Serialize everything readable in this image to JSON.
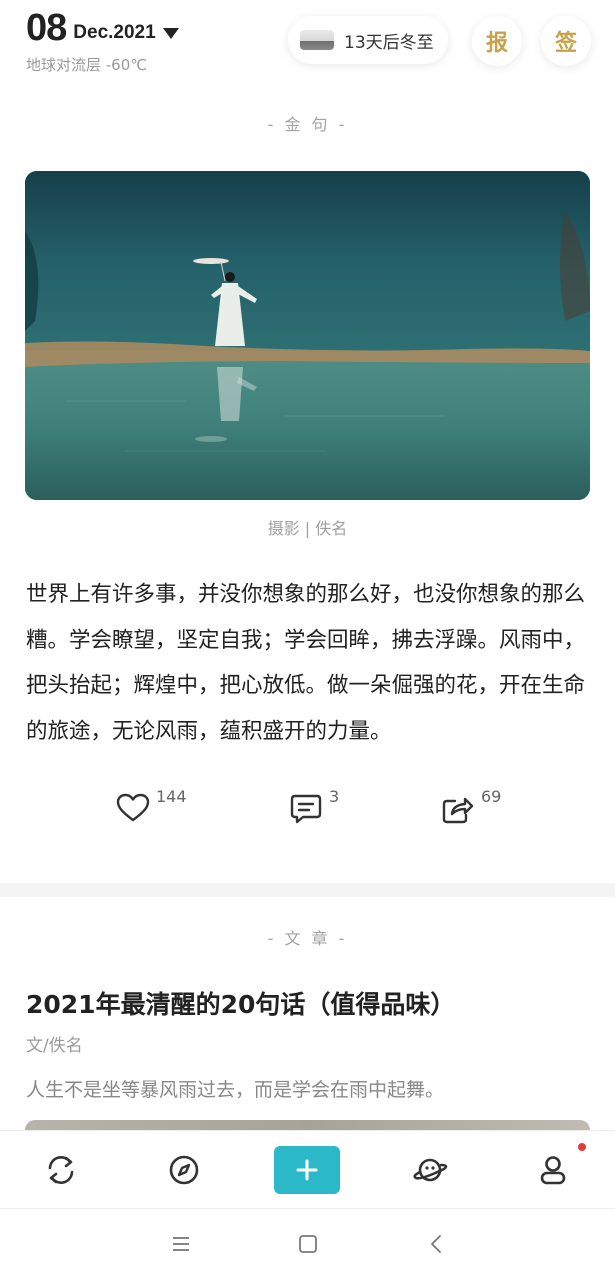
{
  "header": {
    "day": "08",
    "month_year": "Dec.2021",
    "weather": "地球对流层 -60℃",
    "solar_term": "13天后冬至",
    "report_label": "报",
    "signin_label": "签"
  },
  "quote_section": {
    "label": "- 金 句 -",
    "photo_caption": "摄影 | 佚名",
    "text": "世界上有许多事，并没你想象的那么好，也没你想象的那么糟。学会瞭望，坚定自我；学会回眸，拂去浮躁。风雨中，把头抬起；辉煌中，把心放低。做一朵倔强的花，开在生命的旅途，无论风雨，蕴积盛开的力量。",
    "likes": "144",
    "comments": "3",
    "shares": "69"
  },
  "article_section": {
    "label": "- 文 章 -",
    "title": "2021年最清醒的20句话（值得品味）",
    "author": "文/佚名",
    "summary": "人生不是坐等暴风雨过去，而是学会在雨中起舞。"
  },
  "bottom_nav": {
    "items": [
      {
        "icon": "refresh-icon"
      },
      {
        "icon": "compass-icon"
      },
      {
        "icon": "plus-icon"
      },
      {
        "icon": "planet-icon"
      },
      {
        "icon": "user-icon"
      }
    ],
    "accent_color": "#2bb8c8",
    "notification_dot_color": "#e53935"
  },
  "system_nav": {
    "items": [
      {
        "icon": "menu-icon"
      },
      {
        "icon": "home-square-icon"
      },
      {
        "icon": "back-chevron-icon"
      }
    ]
  },
  "colors": {
    "gold": "#c9a14b",
    "text": "#222222",
    "muted": "#9a9a9a"
  }
}
